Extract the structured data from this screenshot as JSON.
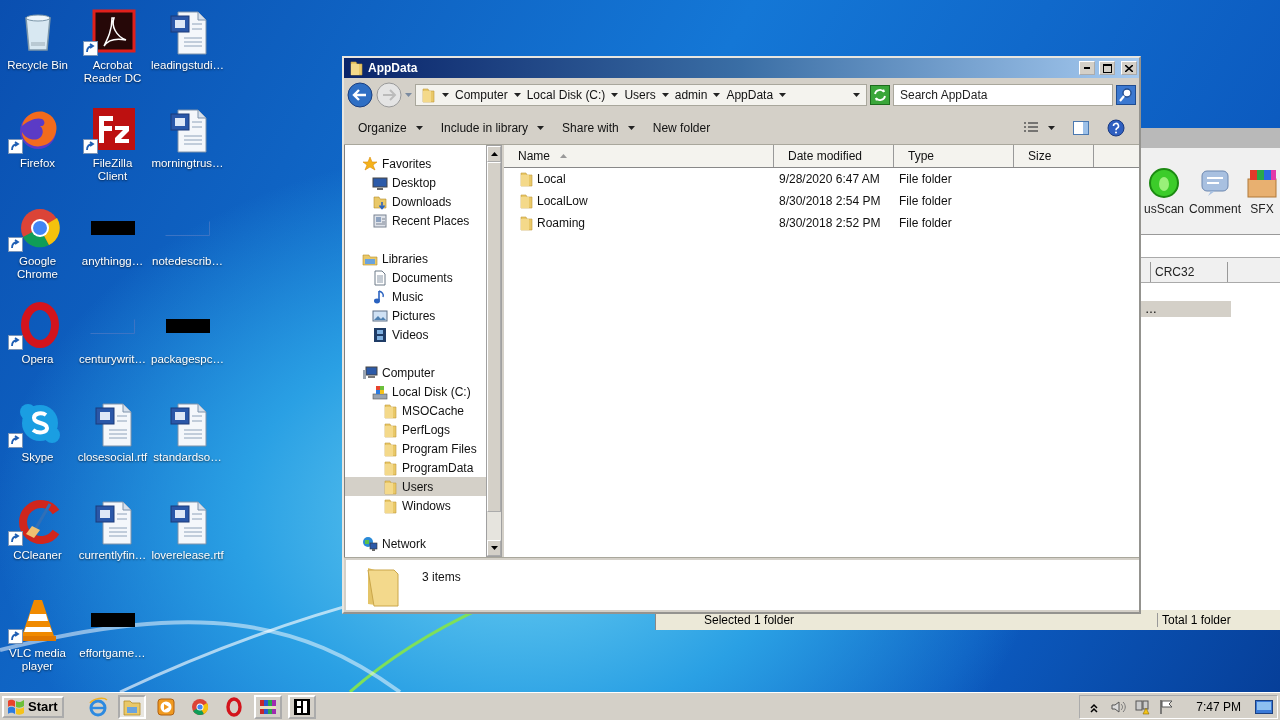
{
  "desktop": {
    "icons": [
      {
        "label": "Recycle Bin",
        "kind": "recycle",
        "shortcut": false
      },
      {
        "label": "Firefox",
        "kind": "firefox",
        "shortcut": true
      },
      {
        "label": "Google Chrome",
        "kind": "chrome",
        "shortcut": true
      },
      {
        "label": "Opera",
        "kind": "opera",
        "shortcut": true
      },
      {
        "label": "Skype",
        "kind": "skype",
        "shortcut": true
      },
      {
        "label": "CCleaner",
        "kind": "ccleaner",
        "shortcut": true
      },
      {
        "label": "VLC media player",
        "kind": "vlc",
        "shortcut": true
      },
      {
        "label": "Acrobat Reader DC",
        "kind": "acrobat",
        "shortcut": true
      },
      {
        "label": "FileZilla Client",
        "kind": "filezilla",
        "shortcut": true
      },
      {
        "label": "anythingg…",
        "kind": "dark_thumb",
        "shortcut": false
      },
      {
        "label": "centurywrit…",
        "kind": "blank_thumb",
        "shortcut": false
      },
      {
        "label": "closesocial.rtf",
        "kind": "word",
        "shortcut": false
      },
      {
        "label": "currentlyfin…",
        "kind": "word",
        "shortcut": false
      },
      {
        "label": "effortgame…",
        "kind": "dark_thumb",
        "shortcut": false
      },
      {
        "label": "leadingstudi…",
        "kind": "word",
        "shortcut": false
      },
      {
        "label": "morningtrus…",
        "kind": "word",
        "shortcut": false
      },
      {
        "label": "notedescrib…",
        "kind": "blank_thumb",
        "shortcut": false
      },
      {
        "label": "packagespc…",
        "kind": "dark_thumb",
        "shortcut": false
      },
      {
        "label": "standardso…",
        "kind": "word",
        "shortcut": false
      },
      {
        "label": "loverelease.rtf",
        "kind": "word",
        "shortcut": false
      }
    ]
  },
  "background_window": {
    "toolbar": [
      {
        "label": "usScan",
        "kind": "scan"
      },
      {
        "label": "Comment",
        "kind": "comment"
      },
      {
        "label": "SFX",
        "kind": "sfx"
      }
    ],
    "columns": [
      "CRC32"
    ],
    "rows": [
      {
        "text": "…",
        "selected": true
      }
    ],
    "status": [
      "Selected 1 folder",
      "Total 1 folder"
    ]
  },
  "window": {
    "title": "AppData",
    "address": {
      "crumbs": [
        "Computer",
        "Local Disk (C:)",
        "Users",
        "admin",
        "AppData"
      ]
    },
    "search": {
      "placeholder": "Search AppData"
    },
    "toolbar": [
      {
        "label": "Organize",
        "dropdown": true
      },
      {
        "label": "Include in library",
        "dropdown": true
      },
      {
        "label": "Share with",
        "dropdown": true
      },
      {
        "label": "New folder",
        "dropdown": false
      }
    ],
    "nav": [
      {
        "label": "Favorites",
        "kind": "star",
        "selected": false,
        "children": [
          {
            "label": "Desktop",
            "kind": "desktop",
            "selected": false
          },
          {
            "label": "Downloads",
            "kind": "downloads",
            "selected": false
          },
          {
            "label": "Recent Places",
            "kind": "recent",
            "selected": false
          }
        ]
      },
      {
        "label": "Libraries",
        "kind": "library",
        "selected": false,
        "children": [
          {
            "label": "Documents",
            "kind": "documents",
            "selected": false
          },
          {
            "label": "Music",
            "kind": "music",
            "selected": false
          },
          {
            "label": "Pictures",
            "kind": "pictures",
            "selected": false
          },
          {
            "label": "Videos",
            "kind": "videos",
            "selected": false
          }
        ]
      },
      {
        "label": "Computer",
        "kind": "computer",
        "selected": false,
        "children": [
          {
            "label": "Local Disk (C:)",
            "kind": "drive",
            "selected": false,
            "children": [
              {
                "label": "MSOCache",
                "kind": "folder",
                "selected": false
              },
              {
                "label": "PerfLogs",
                "kind": "folder",
                "selected": false
              },
              {
                "label": "Program Files",
                "kind": "folder",
                "selected": false
              },
              {
                "label": "ProgramData",
                "kind": "folder",
                "selected": false
              },
              {
                "label": "Users",
                "kind": "folder",
                "selected": true
              },
              {
                "label": "Windows",
                "kind": "folder",
                "selected": false
              }
            ]
          }
        ]
      },
      {
        "label": "Network",
        "kind": "network",
        "selected": false
      }
    ],
    "table": {
      "columns": [
        {
          "label": "Name",
          "sorted": true
        },
        {
          "label": "Date modified",
          "sorted": false
        },
        {
          "label": "Type",
          "sorted": false
        },
        {
          "label": "Size",
          "sorted": false
        }
      ],
      "rows": [
        {
          "name": "Local",
          "date": "9/28/2020 6:47 AM",
          "type": "File folder"
        },
        {
          "name": "LocalLow",
          "date": "8/30/2018 2:54 PM",
          "type": "File folder"
        },
        {
          "name": "Roaming",
          "date": "8/30/2018 2:52 PM",
          "type": "File folder"
        }
      ]
    },
    "details": {
      "count": "3 items"
    }
  },
  "taskbar": {
    "start": "Start",
    "items": [
      {
        "kind": "ie",
        "selected": false,
        "running": false
      },
      {
        "kind": "explorer",
        "selected": true,
        "running": true
      },
      {
        "kind": "media",
        "selected": false,
        "running": false
      },
      {
        "kind": "chrome",
        "selected": false,
        "running": false
      },
      {
        "kind": "opera",
        "selected": false,
        "running": false
      },
      {
        "kind": "winrar",
        "selected": false,
        "running": true
      },
      {
        "kind": "app",
        "selected": false,
        "running": true
      }
    ],
    "tray": {
      "clock": "7:47 PM"
    }
  }
}
